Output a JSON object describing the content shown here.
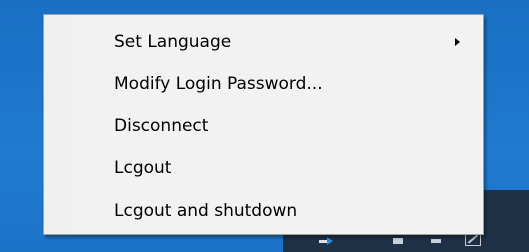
{
  "context_menu": {
    "items": [
      {
        "label": "Set Language",
        "has_submenu": true
      },
      {
        "label": "Modify Login Password..."
      },
      {
        "label": "Disconnect"
      },
      {
        "label": "Lcgout"
      },
      {
        "label": "Lcgout and shutdown"
      }
    ]
  },
  "taskbar": {
    "tray_icons": [
      "network-icon",
      "volume-icon",
      "keyboard-icon",
      "resize-icon"
    ]
  },
  "colors": {
    "desktop": "#1c74c9",
    "taskbar": "#1e3147",
    "menu_background": "#f2f2f2",
    "menu_border": "#a0a0a0"
  }
}
